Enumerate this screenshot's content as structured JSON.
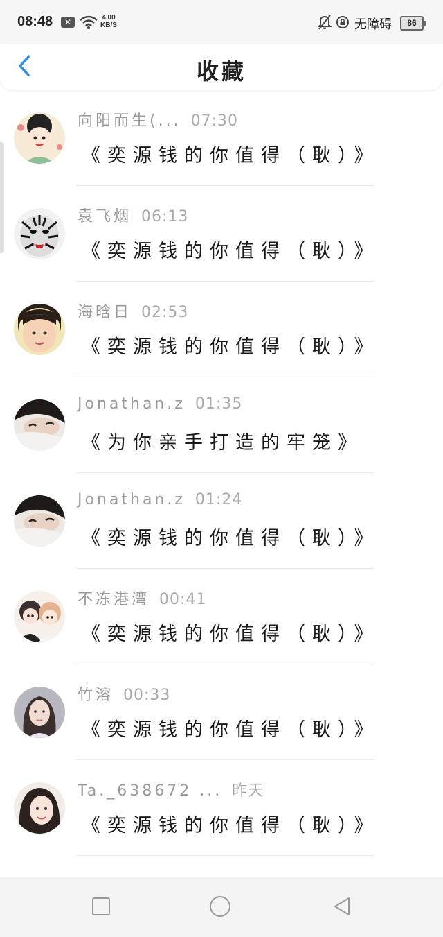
{
  "status_bar": {
    "time": "08:48",
    "speed_top": "4.00",
    "speed_bottom": "KB/S",
    "accessibility": "无障碍",
    "battery": "86"
  },
  "header": {
    "title": "收藏"
  },
  "items": [
    {
      "name": "向阳而生(...",
      "time": "07:30",
      "message": "《奕源钱的你值得（耿）》",
      "avatar_color": "#f3e3c8"
    },
    {
      "name": "袁飞烟",
      "time": "06:13",
      "message": "《奕源钱的你值得（耿）》",
      "avatar_color": "#e8e8e8"
    },
    {
      "name": "海晗日",
      "time": "02:53",
      "message": "《奕源钱的你值得（耿）》",
      "avatar_color": "#e9c9a6"
    },
    {
      "name": "Jonathan.z",
      "time": "01:35",
      "message": "《为你亲手打造的牢笼》",
      "avatar_color": "#d9d2cc"
    },
    {
      "name": "Jonathan.z",
      "time": "01:24",
      "message": "《奕源钱的你值得（耿）》",
      "avatar_color": "#d9d2cc"
    },
    {
      "name": "不冻港湾",
      "time": "00:41",
      "message": "《奕源钱的你值得（耿）》",
      "avatar_color": "#f0dcd0"
    },
    {
      "name": "竹溶",
      "time": "00:33",
      "message": "《奕源钱的你值得（耿）》",
      "avatar_color": "#c9c8d0"
    },
    {
      "name": "Ta._638672 ...",
      "time": "昨天",
      "message": "《奕源钱的你值得（耿）》",
      "avatar_color": "#ead7cc"
    }
  ],
  "nav": {
    "square": "square-icon",
    "circle": "circle-icon",
    "back": "triangle-back-icon"
  }
}
